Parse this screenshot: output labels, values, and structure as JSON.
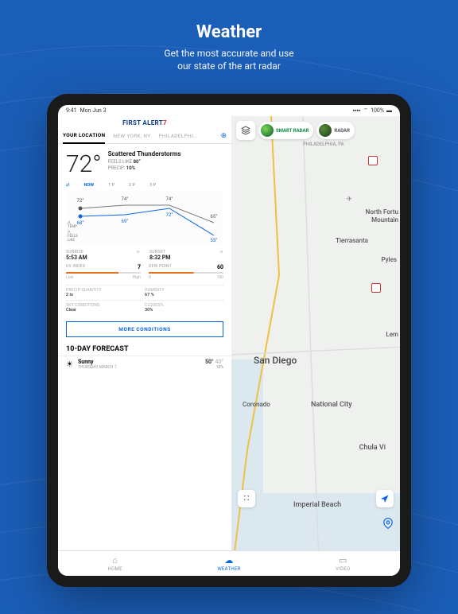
{
  "hero": {
    "title": "Weather",
    "line1": "Get the most accurate and use",
    "line2": "our state of the art radar"
  },
  "status": {
    "time": "9:41",
    "date": "Mon Jun 3",
    "wifi": "100%"
  },
  "brand": {
    "first": "FIRST ALERT",
    "seven": "7"
  },
  "loc_tabs": {
    "active": "YOUR LOCATION",
    "t1": "NEW YORK, NY",
    "t2": "PHILADELPHI…"
  },
  "current": {
    "temp": "72°",
    "cond": "Scattered Thunderstorms",
    "feels_lbl": "FEELS LIKE",
    "feels": "80°",
    "precip_lbl": "PRECIP:",
    "precip": "10%"
  },
  "hourly": {
    "now": "NOW",
    "h1": "1 P",
    "h2": "2 P",
    "h3": "3 P"
  },
  "chart_data": {
    "type": "line",
    "categories": [
      "NOW",
      "1 P",
      "2 P",
      "3 P"
    ],
    "series": [
      {
        "name": "TEMP",
        "values": [
          72,
          74,
          74,
          65
        ]
      },
      {
        "name": "FEELS LIKE",
        "values": [
          68,
          69,
          72,
          55
        ]
      }
    ],
    "legend": [
      "TEMP",
      "FEELS LIKE"
    ]
  },
  "sun": {
    "sunrise_lbl": "SUNRISE",
    "sunrise": "5:53 AM",
    "sunset_lbl": "SUNSET",
    "sunset": "8:32 PM"
  },
  "uv": {
    "uv_lbl": "UV INDEX",
    "uv": "7",
    "uv_lo": "Low",
    "uv_hi": "High",
    "dew_lbl": "DEW POINT",
    "dew": "60",
    "dew_lo": "0",
    "dew_hi": "100"
  },
  "details": {
    "pq_lbl": "PRECIP QUANTITY",
    "pq": "2 in",
    "hum_lbl": "HUMIDITY",
    "hum": "67 %",
    "sky_lbl": "SKY CONDITIONS",
    "sky": "Clear",
    "cloud_lbl": "CLOUDS%",
    "cloud": "30%"
  },
  "more_btn": "MORE CONDITIONS",
  "forecast": {
    "header": "10-DAY FORECAST",
    "cond": "Sunny",
    "date": "THURSDAY, MARCH 1",
    "hi": "50°",
    "lo": "40°",
    "prec": "10%"
  },
  "map": {
    "loc1": "PHILADELPHIA, PA",
    "sd": "San Diego",
    "coronado": "Coronado",
    "nc": "National City",
    "cv": "Chula Vi",
    "ib": "Imperial Beach",
    "nf": "North Fortu",
    "mtn": "Mountain",
    "tierra": "Tierrasanta",
    "pyles": "Pyles",
    "lem": "Lem"
  },
  "radar": {
    "smart": "SMART RADAR",
    "radar": "RADAR"
  },
  "nav": {
    "home": "HOME",
    "weather": "WEATHER",
    "video": "VIDEO"
  }
}
